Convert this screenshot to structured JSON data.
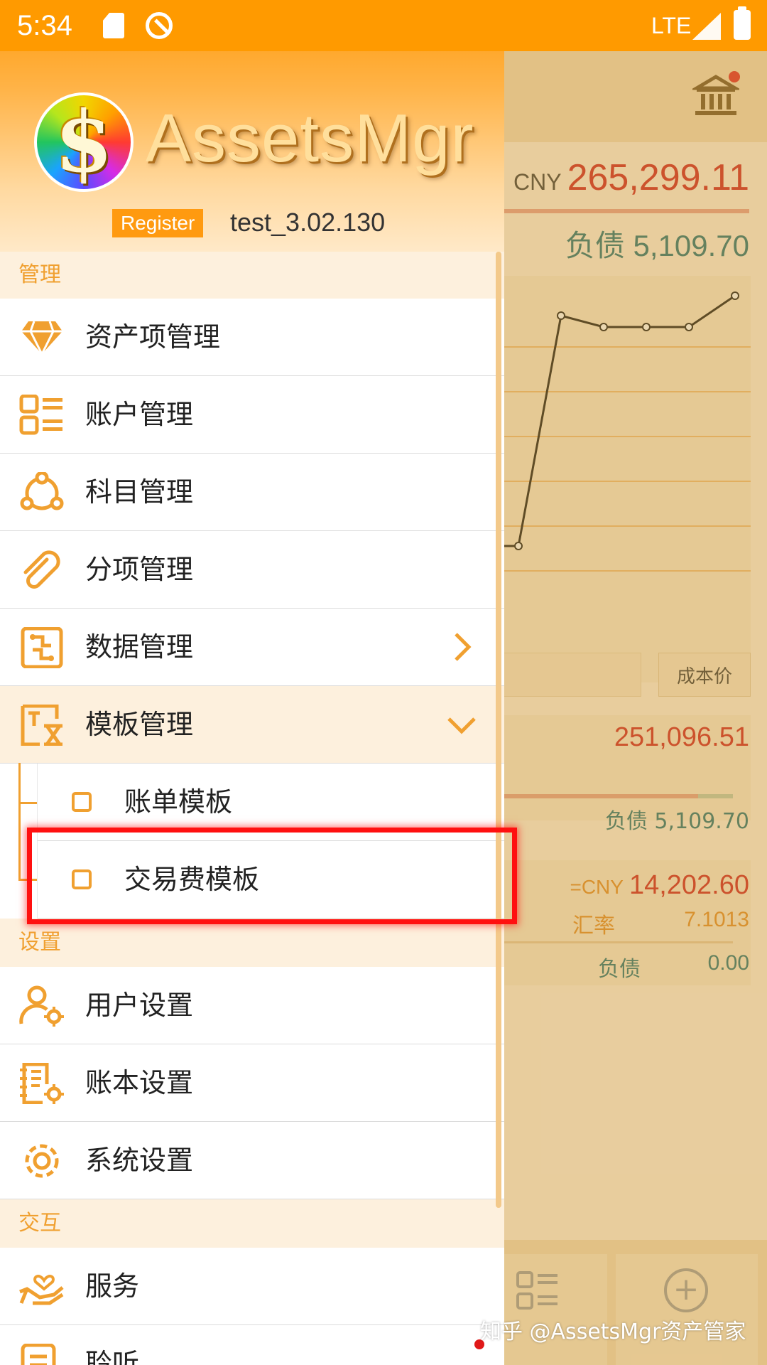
{
  "status_bar": {
    "time": "5:34",
    "network": "LTE"
  },
  "background": {
    "total_currency": "CNY",
    "total_amount": "265,299.11",
    "debt": "负债 5,109.70",
    "cost_button": "成本价",
    "card1": {
      "amount": "251,096.51",
      "debt": "负债 5,109.70"
    },
    "card2": {
      "currency": "=CNY",
      "amount": "14,202.60",
      "rate_label": "汇率",
      "rate_value": "7.1013",
      "debt_label": "负债",
      "debt_value": "0.00"
    },
    "chart_data": {
      "type": "line",
      "x": [
        1,
        2,
        3,
        4,
        5,
        6
      ],
      "y": [
        0.05,
        0.86,
        0.82,
        0.82,
        0.82,
        0.93
      ]
    }
  },
  "drawer": {
    "app_name": "AssetsMgr",
    "register_label": "Register",
    "username": "test_3.02.130",
    "sections": {
      "manage": "管理",
      "settings": "设置",
      "interact": "交互"
    },
    "manage_items": [
      {
        "label": "资产项管理",
        "icon": "diamond-icon"
      },
      {
        "label": "账户管理",
        "icon": "account-list-icon"
      },
      {
        "label": "科目管理",
        "icon": "share-nodes-icon"
      },
      {
        "label": "分项管理",
        "icon": "paperclip-icon"
      },
      {
        "label": "数据管理",
        "icon": "data-icon"
      },
      {
        "label": "模板管理",
        "icon": "template-icon"
      }
    ],
    "template_sub_items": [
      {
        "label": "账单模板"
      },
      {
        "label": "交易费模板"
      }
    ],
    "settings_items": [
      {
        "label": "用户设置",
        "icon": "user-settings-icon"
      },
      {
        "label": "账本设置",
        "icon": "ledger-settings-icon"
      },
      {
        "label": "系统设置",
        "icon": "gear-icon"
      }
    ],
    "interact_items": [
      {
        "label": "服务",
        "icon": "service-hand-icon"
      },
      {
        "label": "聆听",
        "icon": "listen-icon"
      }
    ]
  },
  "watermark": "知乎 @AssetsMgr资产管家",
  "colors": {
    "accent": "#ff9a00",
    "icon": "#f0a030",
    "highlight": "#ff1010",
    "negative": "#cc1a1a",
    "debt": "#1a6b70"
  }
}
